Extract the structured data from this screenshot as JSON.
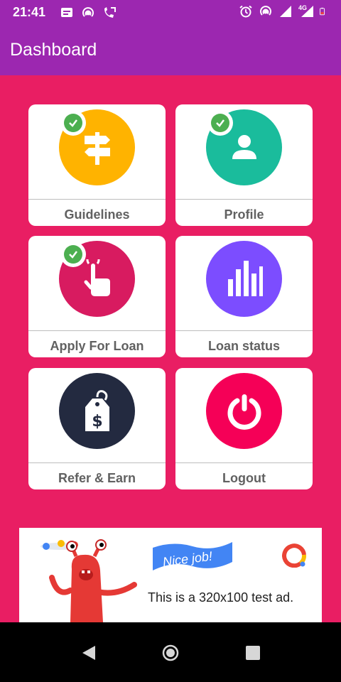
{
  "status_bar": {
    "time": "21:41",
    "network": "4G",
    "left_icons": [
      "message-icon",
      "hotspot-icon",
      "call-forward-icon"
    ],
    "right_icons": [
      "alarm-icon",
      "hotspot-icon",
      "signal-icon",
      "signal-4g-icon",
      "battery-icon"
    ]
  },
  "app_bar": {
    "title": "Dashboard",
    "color": "#9C27B0"
  },
  "dashboard": {
    "background": "#E91E63",
    "cards": [
      {
        "label": "Guidelines",
        "icon": "signpost-icon",
        "color": "#FFB300",
        "checked": true
      },
      {
        "label": "Profile",
        "icon": "person-icon",
        "color": "#1ABC9C",
        "checked": true
      },
      {
        "label": "Apply For Loan",
        "icon": "tap-hand-icon",
        "color": "#D81B60",
        "checked": true
      },
      {
        "label": "Loan status",
        "icon": "bar-chart-icon",
        "color": "#7C4DFF",
        "checked": false
      },
      {
        "label": "Refer & Earn",
        "icon": "price-tag-icon",
        "color": "#232A40",
        "checked": false
      },
      {
        "label": "Logout",
        "icon": "power-icon",
        "color": "#F50057",
        "checked": false
      }
    ]
  },
  "ad": {
    "banner_text": "Nice job!",
    "body_text": "This is a 320x100 test ad."
  },
  "nav_bar": {
    "buttons": [
      "back-icon",
      "home-icon",
      "recents-icon"
    ]
  }
}
